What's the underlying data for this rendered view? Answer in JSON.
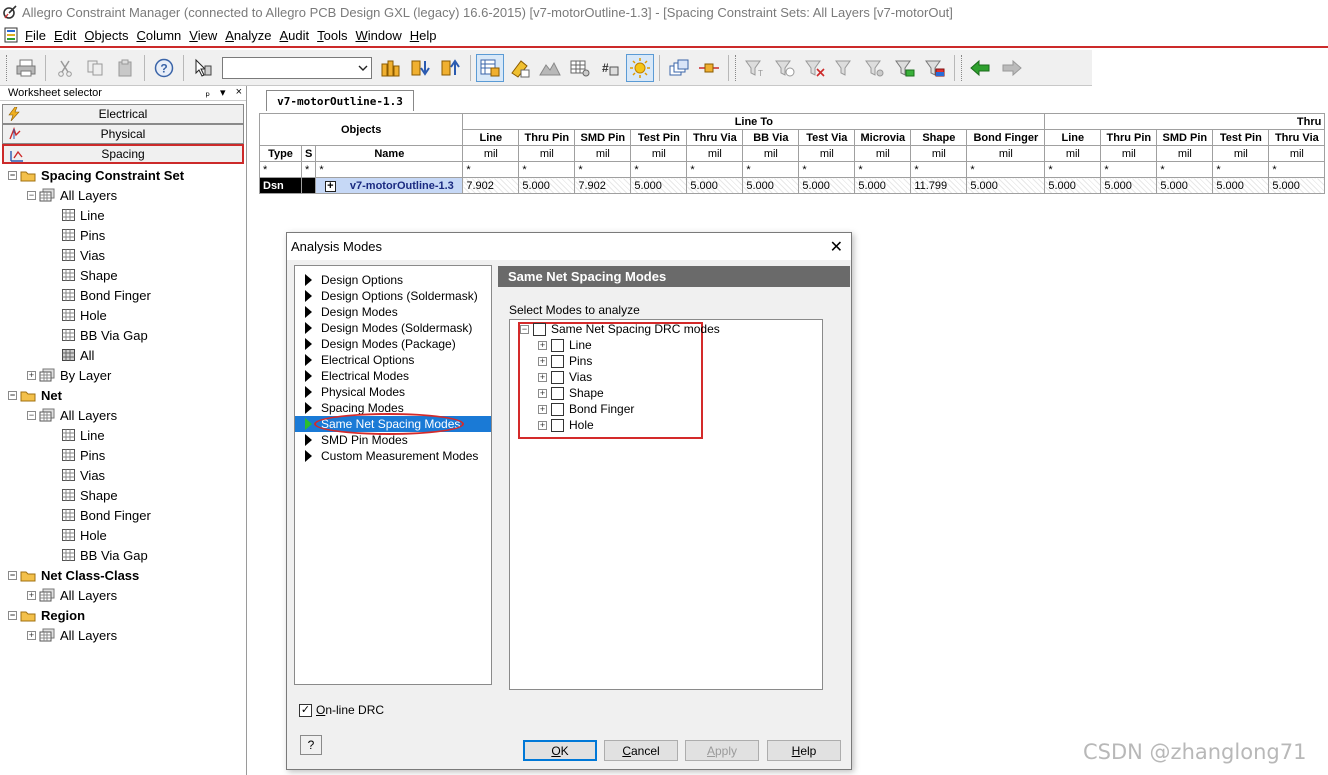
{
  "window": {
    "title": "Allegro Constraint Manager (connected to Allegro PCB Design GXL (legacy) 16.6-2015) [v7-motorOutline-1.3] - [Spacing Constraint Sets:  All Layers [v7-motorOut]"
  },
  "menu": {
    "items": [
      {
        "u": "F",
        "rest": "ile"
      },
      {
        "u": "E",
        "rest": "dit"
      },
      {
        "u": "O",
        "rest": "bjects"
      },
      {
        "u": "C",
        "rest": "olumn"
      },
      {
        "u": "V",
        "rest": "iew"
      },
      {
        "u": "A",
        "rest": "nalyze"
      },
      {
        "u": "A",
        "rest": "udit"
      },
      {
        "u": "T",
        "rest": "ools"
      },
      {
        "u": "W",
        "rest": "indow"
      },
      {
        "u": "H",
        "rest": "elp"
      }
    ]
  },
  "worksheet": {
    "header": "Worksheet selector",
    "header_controls": [
      "ₚ",
      "▾",
      "×"
    ],
    "buttons": [
      "Electrical",
      "Physical",
      "Spacing"
    ],
    "tree": [
      {
        "label": "Spacing Constraint Set",
        "level": 0,
        "bold": true,
        "icon": "folder",
        "pm": "-"
      },
      {
        "label": "All Layers",
        "level": 1,
        "icon": "grid-stack",
        "pm": "-"
      },
      {
        "label": "Line",
        "level": 2,
        "icon": "grid"
      },
      {
        "label": "Pins",
        "level": 2,
        "icon": "grid"
      },
      {
        "label": "Vias",
        "level": 2,
        "icon": "grid"
      },
      {
        "label": "Shape",
        "level": 2,
        "icon": "grid"
      },
      {
        "label": "Bond Finger",
        "level": 2,
        "icon": "grid"
      },
      {
        "label": "Hole",
        "level": 2,
        "icon": "grid"
      },
      {
        "label": "BB Via Gap",
        "level": 2,
        "icon": "grid"
      },
      {
        "label": "All",
        "level": 2,
        "icon": "grid-dark"
      },
      {
        "label": "By Layer",
        "level": 1,
        "icon": "grid-stack",
        "pm": "+"
      },
      {
        "label": "Net",
        "level": 0,
        "bold": true,
        "icon": "folder",
        "pm": "-"
      },
      {
        "label": "All Layers",
        "level": 1,
        "icon": "grid-stack",
        "pm": "-"
      },
      {
        "label": "Line",
        "level": 2,
        "icon": "grid"
      },
      {
        "label": "Pins",
        "level": 2,
        "icon": "grid"
      },
      {
        "label": "Vias",
        "level": 2,
        "icon": "grid"
      },
      {
        "label": "Shape",
        "level": 2,
        "icon": "grid"
      },
      {
        "label": "Bond Finger",
        "level": 2,
        "icon": "grid"
      },
      {
        "label": "Hole",
        "level": 2,
        "icon": "grid"
      },
      {
        "label": "BB Via Gap",
        "level": 2,
        "icon": "grid"
      },
      {
        "label": "Net Class-Class",
        "level": 0,
        "bold": true,
        "icon": "folder",
        "pm": "-"
      },
      {
        "label": "All Layers",
        "level": 1,
        "icon": "grid-stack",
        "pm": "+"
      },
      {
        "label": "Region",
        "level": 0,
        "bold": true,
        "icon": "folder",
        "pm": "-"
      },
      {
        "label": "All Layers",
        "level": 1,
        "icon": "grid-stack",
        "pm": "+"
      }
    ]
  },
  "tab": {
    "label": "v7-motorOutline-1.3"
  },
  "grid": {
    "objects_header": "Objects",
    "group1": "Line To",
    "group2": "Thru",
    "sub_headers": {
      "type": "Type",
      "s": "S",
      "name": "Name"
    },
    "columns": [
      "Line",
      "Thru Pin",
      "SMD Pin",
      "Test Pin",
      "Thru Via",
      "BB Via",
      "Test Via",
      "Microvia",
      "Shape",
      "Bond Finger",
      "Line",
      "Thru Pin",
      "SMD Pin",
      "Test Pin",
      "Thru Via"
    ],
    "unit": "mil",
    "filter": "*",
    "row": {
      "type": "Dsn",
      "expander": "+",
      "name": "v7-motorOutline-1.3",
      "values": [
        "7.902",
        "5.000",
        "7.902",
        "5.000",
        "5.000",
        "5.000",
        "5.000",
        "5.000",
        "11.799",
        "5.000",
        "5.000",
        "5.000",
        "5.000",
        "5.000",
        "5.000"
      ]
    }
  },
  "dialog": {
    "title": "Analysis Modes",
    "close": "✕",
    "modes": [
      "Design Options",
      "Design Options (Soldermask)",
      "Design Modes",
      "Design Modes (Soldermask)",
      "Design Modes (Package)",
      "Electrical Options",
      "Electrical Modes",
      "Physical Modes",
      "Spacing Modes",
      "Same Net Spacing Modes",
      "SMD Pin Modes",
      "Custom Measurement Modes"
    ],
    "selected_index": 9,
    "panel_title": "Same Net Spacing Modes",
    "select_label": "Select Modes to analyze",
    "tree_root": "Same Net Spacing DRC modes",
    "tree_children": [
      "Line",
      "Pins",
      "Vias",
      "Shape",
      "Bond Finger",
      "Hole"
    ],
    "online_drc": {
      "u": "O",
      "rest": "n-line DRC",
      "checked": true
    },
    "help_q": "?",
    "buttons": {
      "ok": {
        "u": "O",
        "rest": "K"
      },
      "cancel": {
        "u": "C",
        "rest": "ancel"
      },
      "apply": {
        "u": "A",
        "rest": "pply"
      },
      "help": {
        "u": "H",
        "rest": "elp"
      }
    }
  },
  "watermark": "CSDN @zhanglong71"
}
